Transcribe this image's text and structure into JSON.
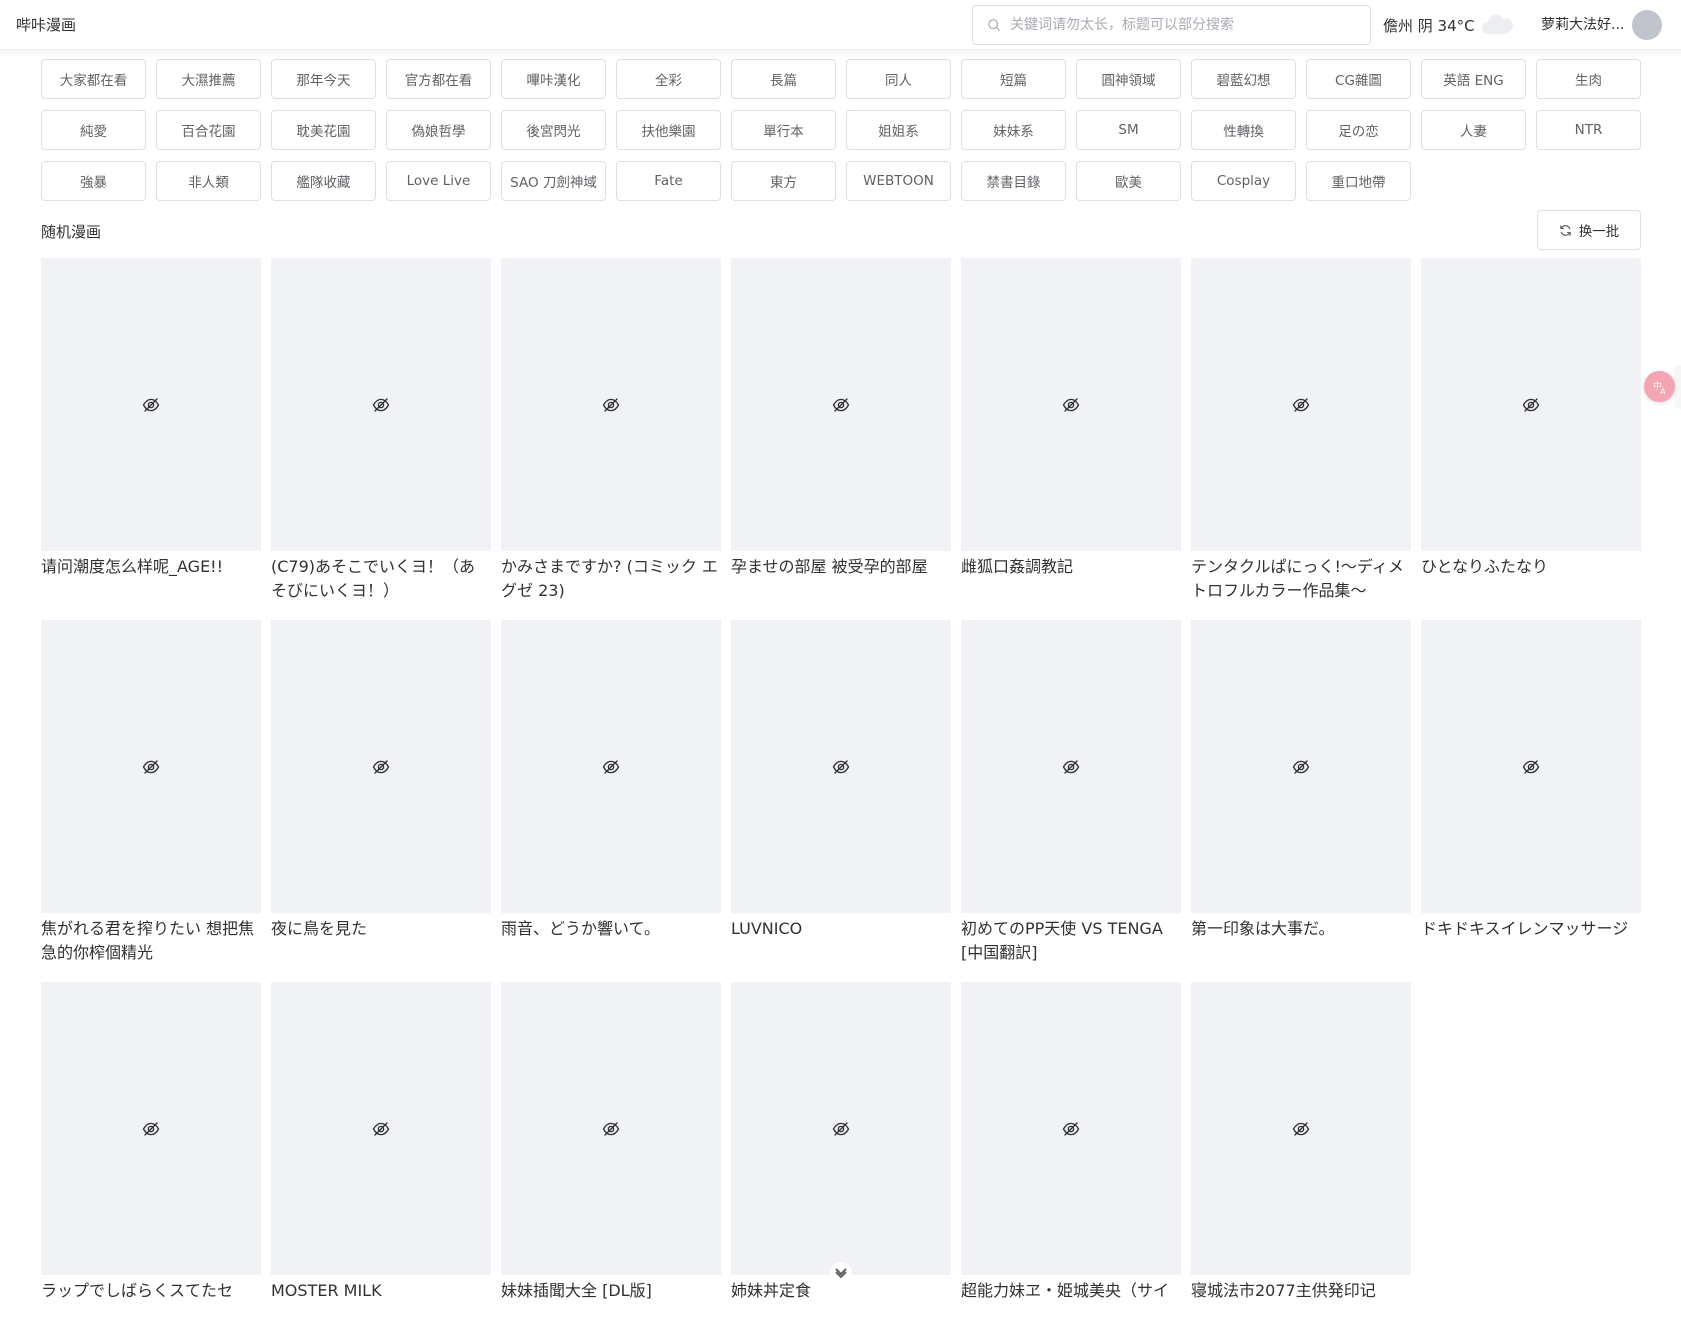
{
  "header": {
    "app_title": "哔咔漫画",
    "search_placeholder": "关键词请勿太长，标题可以部分搜索",
    "weather": "儋州 阴 34°C",
    "user_name": "萝莉大法好..."
  },
  "categories": [
    "大家都在看",
    "大濕推薦",
    "那年今天",
    "官方都在看",
    "嗶咔漢化",
    "全彩",
    "長篇",
    "同人",
    "短篇",
    "圓神領域",
    "碧藍幻想",
    "CG雜圖",
    "英語 ENG",
    "生肉",
    "純愛",
    "百合花園",
    "耽美花園",
    "偽娘哲學",
    "後宮閃光",
    "扶他樂園",
    "單行本",
    "姐姐系",
    "妹妹系",
    "SM",
    "性轉換",
    "足の恋",
    "人妻",
    "NTR",
    "強暴",
    "非人類",
    "艦隊收藏",
    "Love Live",
    "SAO 刀劍神域",
    "Fate",
    "東方",
    "WEBTOON",
    "禁書目錄",
    "歐美",
    "Cosplay",
    "重口地帶"
  ],
  "section": {
    "title": "随机漫画",
    "refresh_label": "换一批"
  },
  "comics": [
    "请问潮度怎么样呢_AGE!!",
    "(C79)あそこでいくヨ！（あそびにいくヨ！）",
    "かみさまですか? (コミック エグゼ 23)",
    "孕ませの部屋 被受孕的部屋",
    "雌狐口姦調教記",
    "テンタクルぱにっく!〜ディメトロフルカラー作品集〜",
    "ひとなりふたなり",
    "焦がれる君を搾りたい 想把焦急的你榨個精光",
    "夜に鳥を見た",
    "雨音、どうか響いて。",
    "LUVNICO",
    "初めてのPP天使 VS TENGA [中国翻訳]",
    "第一印象は大事だ。",
    "ドキドキスイレンマッサージ",
    "ラップでしばらくスてたセ",
    "MOSTER MILK",
    "妹妹插聞大全 [DL版]",
    "姉妹丼定食",
    "超能力妹ヱ・姫城美央（サイ",
    "寝城法市2077主供発印记"
  ]
}
